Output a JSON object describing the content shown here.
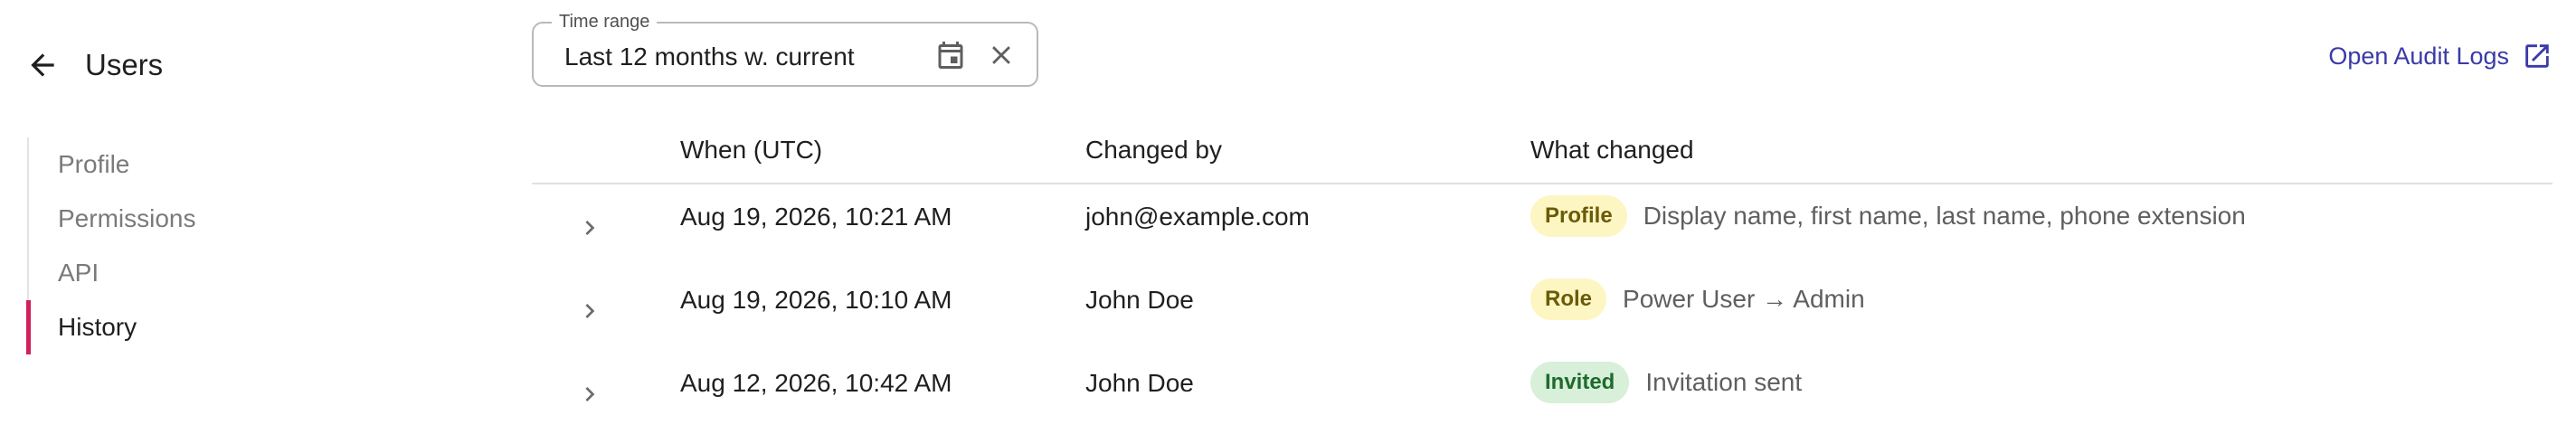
{
  "header": {
    "title": "Users",
    "back_icon": "arrow-left-icon"
  },
  "sidebar": {
    "items": [
      {
        "label": "Profile",
        "active": false
      },
      {
        "label": "Permissions",
        "active": false
      },
      {
        "label": "API",
        "active": false
      },
      {
        "label": "History",
        "active": true
      }
    ],
    "accent_color": "#d21f5d"
  },
  "filter": {
    "label": "Time range",
    "value": "Last 12 months w. current",
    "calendar_icon": "calendar-icon",
    "clear_icon": "close-icon"
  },
  "audit_link": {
    "label": "Open Audit Logs",
    "icon": "external-link-icon",
    "color": "#3a3aa8"
  },
  "table": {
    "columns": [
      "When (UTC)",
      "Changed by",
      "What changed"
    ],
    "rows": [
      {
        "when": "Aug 19, 2026, 10:21 AM",
        "by": "john@example.com",
        "badge": "Profile",
        "badge_bg": "#fdf6c3",
        "badge_color": "#6b5a08",
        "change": "Display name, first name, last name, phone extension"
      },
      {
        "when": "Aug 19, 2026, 10:10 AM",
        "by": "John Doe",
        "badge": "Role",
        "badge_bg": "#fdf6c3",
        "badge_color": "#6b5a08",
        "change": "Power User → Admin"
      },
      {
        "when": "Aug 12, 2026, 10:42 AM",
        "by": "John Doe",
        "badge": "Invited",
        "badge_bg": "#d8efd9",
        "badge_color": "#1e6b2c",
        "change": "Invitation sent"
      }
    ]
  }
}
